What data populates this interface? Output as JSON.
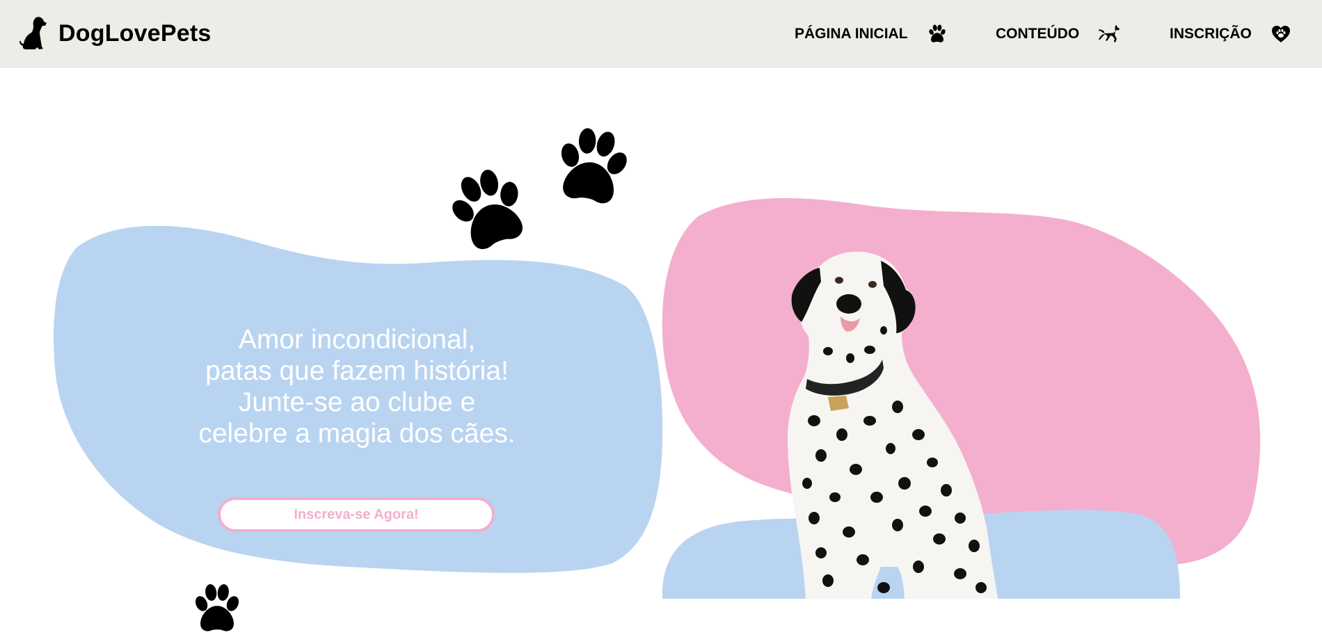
{
  "header": {
    "brand": {
      "name": "DogLovePets",
      "logo_icon": "sitting-dog-icon"
    },
    "nav": [
      {
        "label": "PÁGINA INICIAL",
        "icon": "paw-icon"
      },
      {
        "label": "CONTEÚDO",
        "icon": "running-dog-icon"
      },
      {
        "label": "INSCRIÇÃO",
        "icon": "heart-paw-icon"
      }
    ]
  },
  "hero": {
    "headline_lines": [
      "Amor incondicional,",
      "patas que fazem história!",
      "Junte-se ao clube e",
      "celebre a magia dos cães."
    ],
    "cta_label": "Inscreva-se Agora!",
    "image": "dalmatian-dog-photo",
    "decorations": [
      "paw-print-icon",
      "paw-print-icon",
      "paw-print-icon"
    ]
  },
  "colors": {
    "header_bg": "#edece6",
    "blue_blob": "#b9d4f1",
    "pink_blob": "#f4afce",
    "cta_accent": "#f3aece",
    "text_dark": "#000000",
    "text_light": "#ffffff"
  }
}
